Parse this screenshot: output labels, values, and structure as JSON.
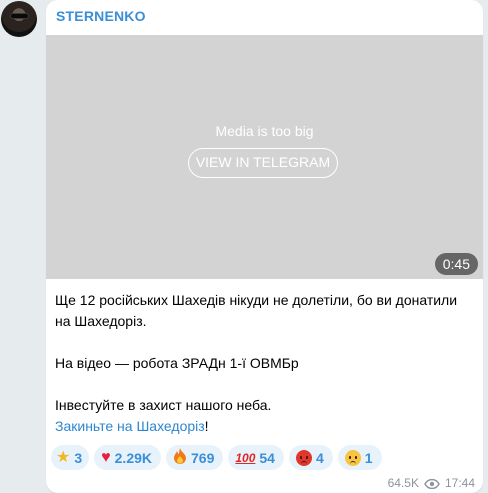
{
  "channel": {
    "name": "STERNENKO"
  },
  "media": {
    "notice": "Media is too big",
    "button_label": "VIEW IN TELEGRAM",
    "duration": "0:45"
  },
  "message": {
    "line1": "Ще 12 російських Шахедів нікуди не долетіли, бо ви донатили на Шахедоріз.",
    "line2": "На відео — робота ЗРАДн 1-ї ОВМБр",
    "line3": "Інвестуйте в захист нашого неба.",
    "link_text": "Закиньте на Шахедоріз",
    "link_suffix": "!"
  },
  "reactions": [
    {
      "icon": "star-icon",
      "count": "3"
    },
    {
      "icon": "heart-icon",
      "count": "2.29K"
    },
    {
      "icon": "fire-icon",
      "count": "769"
    },
    {
      "icon": "hundred-icon",
      "count": "54"
    },
    {
      "icon": "angry-face-icon",
      "count": "4"
    },
    {
      "icon": "crying-face-icon",
      "count": "1"
    }
  ],
  "meta": {
    "views": "64.5K",
    "time": "17:44"
  },
  "colors": {
    "accent": "#3a8fd6",
    "link": "#2d86cf",
    "background": "#e6ebee",
    "reaction_bg": "#e8f2fb"
  }
}
